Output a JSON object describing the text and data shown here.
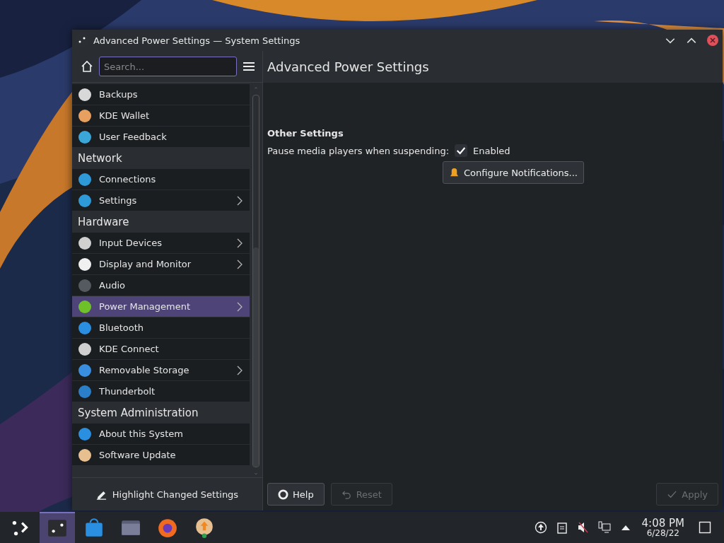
{
  "window": {
    "title": "Advanced Power Settings — System Settings"
  },
  "sidebar": {
    "search": {
      "placeholder": "Search..."
    },
    "groups": [
      {
        "items": [
          {
            "label": "Backups",
            "arrow": false,
            "selected": false
          },
          {
            "label": "KDE Wallet",
            "arrow": false,
            "selected": false
          },
          {
            "label": "User Feedback",
            "arrow": false,
            "selected": false
          }
        ]
      },
      {
        "title": "Network",
        "items": [
          {
            "label": "Connections",
            "arrow": false,
            "selected": false
          },
          {
            "label": "Settings",
            "arrow": true,
            "selected": false
          }
        ]
      },
      {
        "title": "Hardware",
        "items": [
          {
            "label": "Input Devices",
            "arrow": true,
            "selected": false
          },
          {
            "label": "Display and Monitor",
            "arrow": true,
            "selected": false
          },
          {
            "label": "Audio",
            "arrow": false,
            "selected": false
          },
          {
            "label": "Power Management",
            "arrow": true,
            "selected": true
          },
          {
            "label": "Bluetooth",
            "arrow": false,
            "selected": false
          },
          {
            "label": "KDE Connect",
            "arrow": false,
            "selected": false
          },
          {
            "label": "Removable Storage",
            "arrow": true,
            "selected": false
          },
          {
            "label": "Thunderbolt",
            "arrow": false,
            "selected": false
          }
        ]
      },
      {
        "title": "System Administration",
        "items": [
          {
            "label": "About this System",
            "arrow": false,
            "selected": false
          },
          {
            "label": "Software Update",
            "arrow": false,
            "selected": false
          }
        ]
      }
    ],
    "footer": "Highlight Changed Settings"
  },
  "page": {
    "title": "Advanced Power Settings",
    "section": "Other Settings",
    "setting": {
      "label": "Pause media players when suspending:",
      "checked": true,
      "value": "Enabled"
    },
    "button": "Configure Notifications..."
  },
  "buttons": [
    {
      "label": "Help",
      "disabled": false
    },
    {
      "label": "Reset",
      "disabled": true
    },
    {
      "label": "Apply",
      "disabled": true
    }
  ],
  "taskbar": {
    "apps": [
      {
        "selected": false
      },
      {
        "selected": true
      },
      {
        "selected": false
      },
      {
        "selected": false
      },
      {
        "selected": false
      },
      {
        "selected": false
      }
    ],
    "time": "4:08 PM",
    "date": "6/28/22"
  }
}
